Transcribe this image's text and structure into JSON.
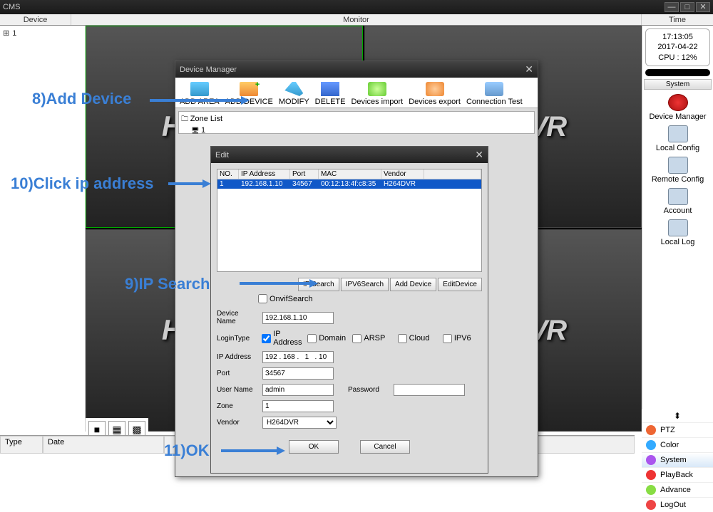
{
  "app_title": "CMS",
  "columns": {
    "device": "Device",
    "monitor": "Monitor",
    "time": "Time"
  },
  "clock": {
    "time": "17:13:05",
    "date": "2017-04-22",
    "cpu": "CPU : 12%"
  },
  "system_header": "System",
  "device_tree_root": "1",
  "video_logo": "H.264DVR",
  "sys_items": [
    "Device Manager",
    "Local Config",
    "Remote Config",
    "Account",
    "Local Log"
  ],
  "log_headers": {
    "type": "Type",
    "date": "Date"
  },
  "right_menu": [
    {
      "label": "PTZ",
      "color": "#e63"
    },
    {
      "label": "Color",
      "color": "#3af"
    },
    {
      "label": "System",
      "color": "#a5e"
    },
    {
      "label": "PlayBack",
      "color": "#e33"
    },
    {
      "label": "Advance",
      "color": "#8d4"
    },
    {
      "label": "LogOut",
      "color": "#e44"
    }
  ],
  "dm": {
    "title": "Device Manager",
    "tools": [
      "ADD AREA",
      "ADD DEVICE",
      "MODIFY",
      "DELETE",
      "Devices import",
      "Devices export",
      "Connection Test"
    ],
    "zone_list_label": "Zone List",
    "zone_item": "1"
  },
  "edit": {
    "title": "Edit",
    "cols": {
      "no": "NO.",
      "ip": "IP Address",
      "port": "Port",
      "mac": "MAC",
      "vendor": "Vendor"
    },
    "row": {
      "no": "1",
      "ip": "192.168.1.10",
      "port": "34567",
      "mac": "00:12:13:4f:c8:35",
      "vendor": "H264DVR"
    },
    "btns": {
      "ipsearch": "IP Search",
      "ipv6": "IPV6Search",
      "add": "Add Device",
      "editdev": "EditDevice"
    },
    "onvif": "OnvifSearch",
    "labels": {
      "devname": "Device Name",
      "logintype": "LoginType",
      "ipaddr": "IP Address",
      "port": "Port",
      "user": "User Name",
      "password": "Password",
      "zone": "Zone",
      "vendor": "Vendor"
    },
    "login_opts": {
      "ip": "IP Address",
      "domain": "Domain",
      "arsp": "ARSP",
      "cloud": "Cloud",
      "ipv6": "IPV6"
    },
    "vals": {
      "devname": "192.168.1.10",
      "ipaddr": "192 . 168 .   1   . 10",
      "port": "34567",
      "user": "admin",
      "password": "",
      "zone": "1",
      "vendor": "H264DVR"
    },
    "ok": "OK",
    "cancel": "Cancel"
  },
  "annotations": {
    "a8": "8)Add Device",
    "a9": "9)IP Search",
    "a10": "10)Click ip address",
    "a11": "11)OK"
  }
}
